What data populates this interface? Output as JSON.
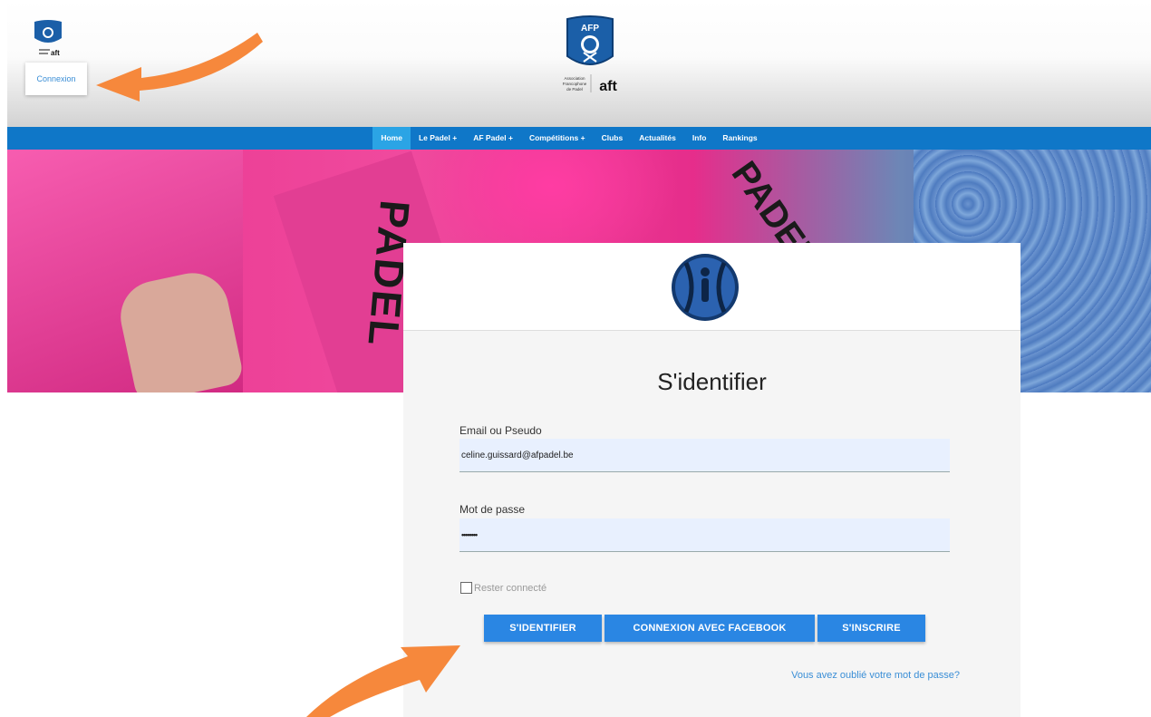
{
  "header": {
    "connexion_label": "Connexion",
    "logo_top_text": "AFP",
    "logo_caption_1": "Association",
    "logo_caption_2": "Francophone",
    "logo_caption_3": "de Padel",
    "logo_brand": "aft"
  },
  "nav": {
    "items": [
      "Home",
      "Le Padel +",
      "AF Padel +",
      "Compétitions +",
      "Clubs",
      "Actualités",
      "Info",
      "Rankings"
    ],
    "active": "Home"
  },
  "hero": {
    "text_1": "PADEL",
    "text_2": "PADEL"
  },
  "login": {
    "title": "S'identifier",
    "email_label": "Email ou Pseudo",
    "email_value": "celine.guissard@afpadel.be",
    "password_label": "Mot de passe",
    "password_value": "••••••••",
    "remember_label": "Rester connecté",
    "submit_label": "S'IDENTIFIER",
    "facebook_label": "CONNEXION AVEC FACEBOOK",
    "register_label": "S'INSCRIRE",
    "forgot_label": "Vous avez oublié votre mot de passe?"
  },
  "colors": {
    "nav_bg": "#0f77c8",
    "nav_active": "#2ba4e5",
    "button": "#2a86e3",
    "arrow": "#f6883c",
    "link": "#3a8ed6"
  }
}
